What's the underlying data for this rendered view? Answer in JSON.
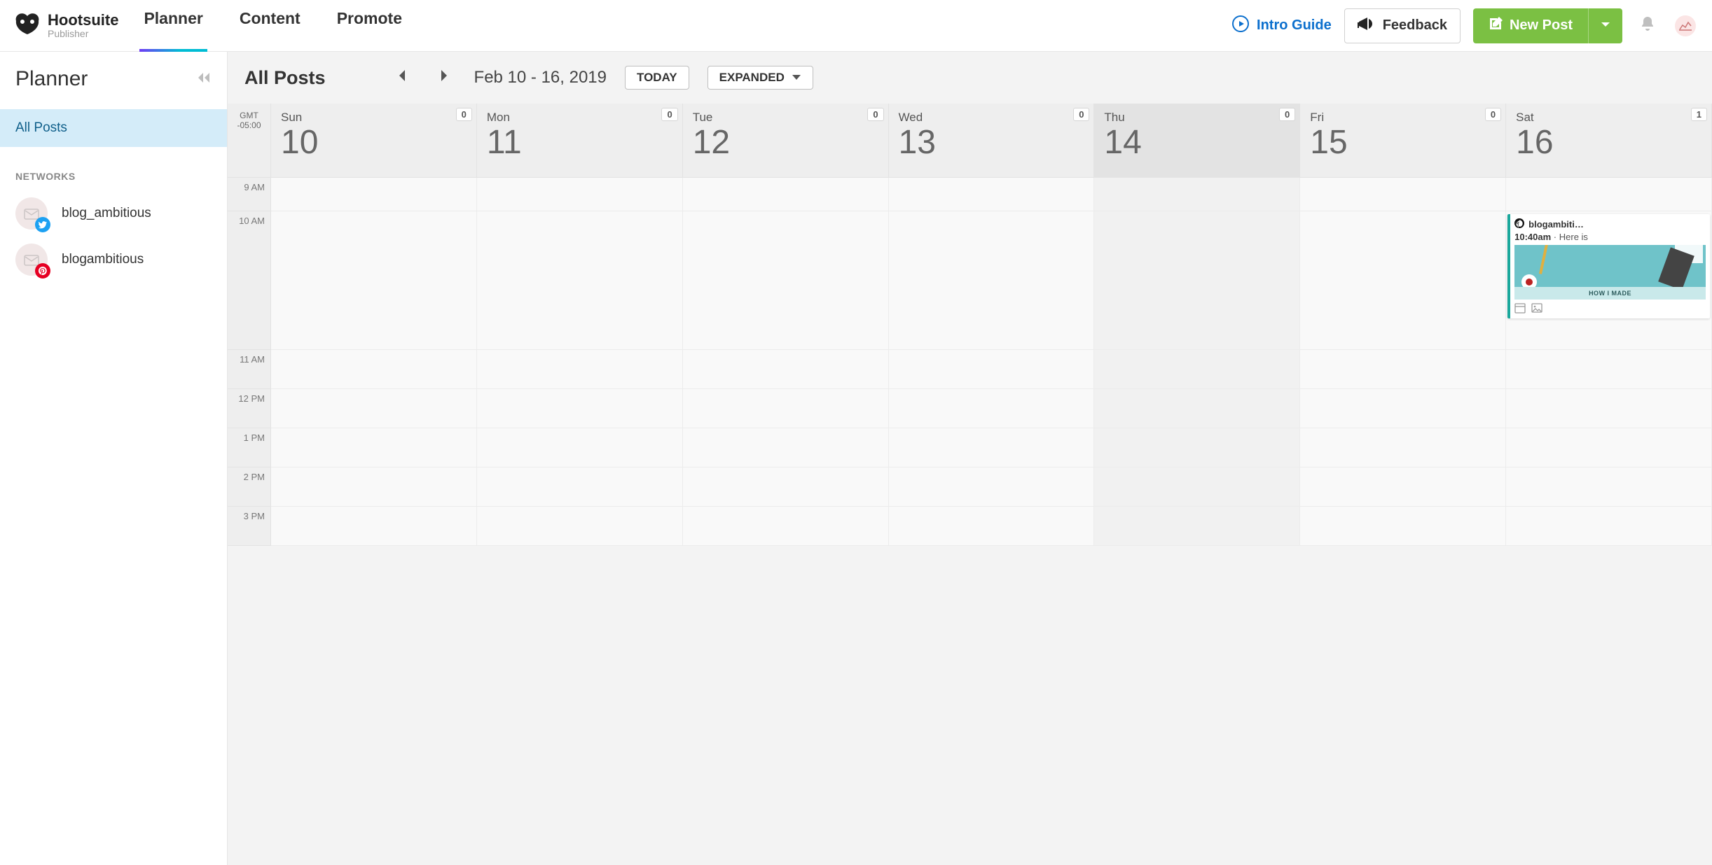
{
  "brand": {
    "name": "Hootsuite",
    "sub": "Publisher"
  },
  "nav": {
    "items": [
      "Planner",
      "Content",
      "Promote"
    ],
    "activeIndex": 0
  },
  "top": {
    "intro": "Intro Guide",
    "feedback": "Feedback",
    "newPost": "New Post"
  },
  "sidebar": {
    "title": "Planner",
    "allPosts": "All Posts",
    "networksLabel": "NETWORKS",
    "networks": [
      {
        "name": "blog_ambitious",
        "platform": "twitter",
        "badgeColor": "#1da1f2"
      },
      {
        "name": "blogambitious",
        "platform": "pinterest",
        "badgeColor": "#e60023"
      }
    ]
  },
  "calendar": {
    "title": "All Posts",
    "range": "Feb 10 - 16, 2019",
    "todayBtn": "TODAY",
    "expandedBtn": "EXPANDED",
    "tz1": "GMT",
    "tz2": "-05:00",
    "days": [
      {
        "name": "Sun",
        "num": "10",
        "count": "0",
        "today": false
      },
      {
        "name": "Mon",
        "num": "11",
        "count": "0",
        "today": false
      },
      {
        "name": "Tue",
        "num": "12",
        "count": "0",
        "today": false
      },
      {
        "name": "Wed",
        "num": "13",
        "count": "0",
        "today": false
      },
      {
        "name": "Thu",
        "num": "14",
        "count": "0",
        "today": true
      },
      {
        "name": "Fri",
        "num": "15",
        "count": "0",
        "today": false
      },
      {
        "name": "Sat",
        "num": "16",
        "count": "1",
        "today": false
      }
    ],
    "hours": [
      "9 AM",
      "10 AM",
      "11 AM",
      "12 PM",
      "1 PM",
      "2 PM",
      "3 PM"
    ],
    "post": {
      "account": "blogambiti…",
      "time": "10:40am",
      "sep": " · ",
      "text": "Here is",
      "imgBand": "HOW I MADE"
    }
  }
}
